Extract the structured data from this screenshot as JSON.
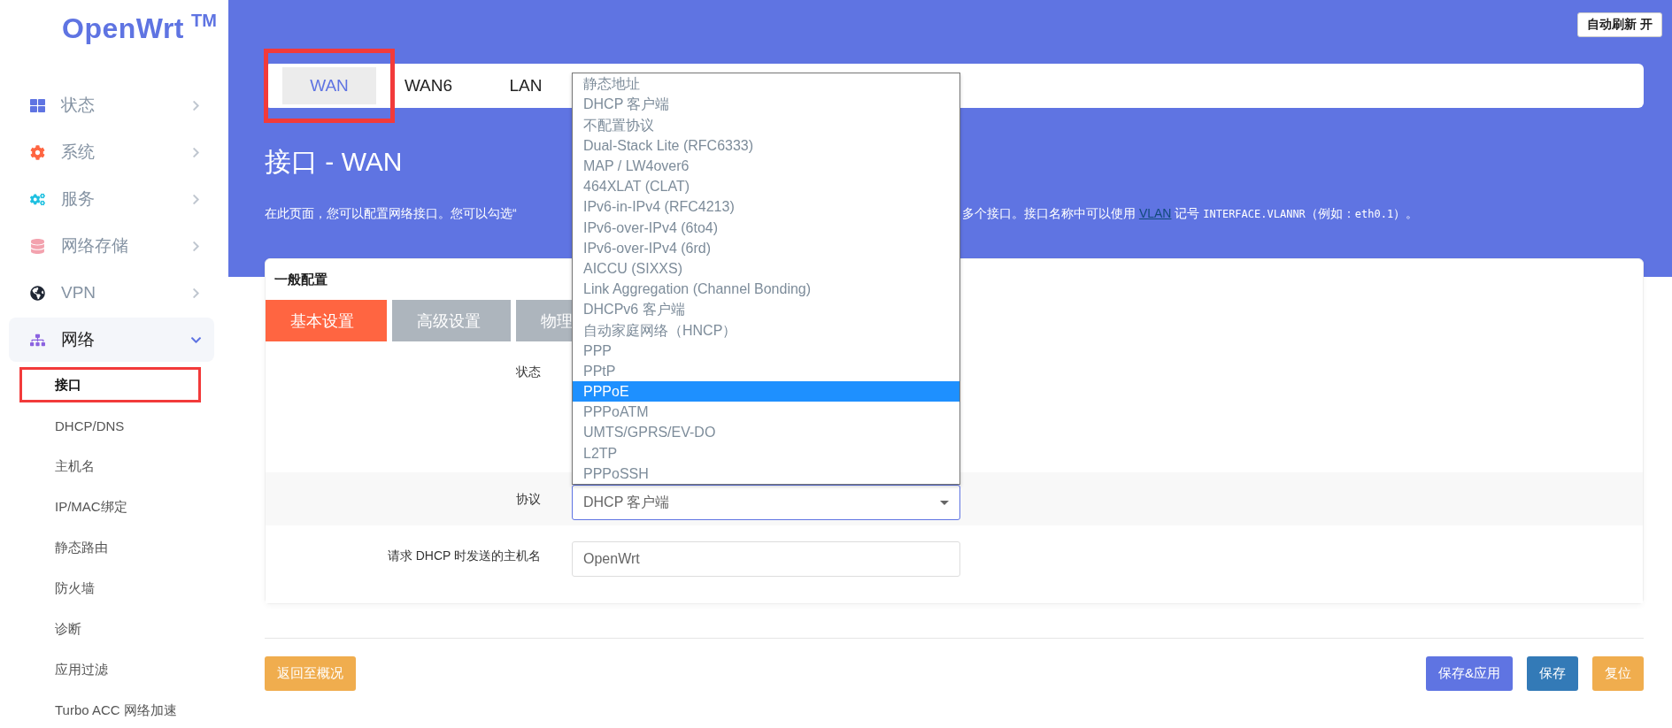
{
  "logo": {
    "name": "OpenWrt",
    "mark": "TM"
  },
  "sidebar": {
    "items": [
      {
        "label": "状态",
        "kind": "status",
        "expanded": false,
        "selected": false
      },
      {
        "label": "系统",
        "kind": "system",
        "expanded": false,
        "selected": false
      },
      {
        "label": "服务",
        "kind": "services",
        "expanded": false,
        "selected": false
      },
      {
        "label": "网络存储",
        "kind": "storage",
        "expanded": false,
        "selected": false
      },
      {
        "label": "VPN",
        "kind": "vpn",
        "expanded": false,
        "selected": false
      },
      {
        "label": "网络",
        "kind": "network",
        "expanded": true,
        "selected": true,
        "children": [
          {
            "label": "接口",
            "selected": true,
            "annotated": true
          },
          {
            "label": "DHCP/DNS",
            "selected": false,
            "annotated": false
          },
          {
            "label": "主机名",
            "selected": false,
            "annotated": false
          },
          {
            "label": "IP/MAC绑定",
            "selected": false,
            "annotated": false
          },
          {
            "label": "静态路由",
            "selected": false,
            "annotated": false
          },
          {
            "label": "防火墙",
            "selected": false,
            "annotated": false
          },
          {
            "label": "诊断",
            "selected": false,
            "annotated": false
          },
          {
            "label": "应用过滤",
            "selected": false,
            "annotated": false
          },
          {
            "label": "Turbo ACC 网络加速",
            "selected": false,
            "annotated": false
          }
        ]
      }
    ]
  },
  "auto_refresh": "自动刷新 开",
  "interface_tabs": [
    {
      "label": "WAN",
      "selected": true,
      "annotated": true
    },
    {
      "label": "WAN6",
      "selected": false,
      "annotated": false
    },
    {
      "label": "LAN",
      "selected": false,
      "annotated": false
    }
  ],
  "page_title": "接口 - WAN",
  "description": {
    "start": "在此页面，您可以配置网络接口。您可以勾选“",
    "end": [
      {
        "kind": "text",
        "text": "多个接口。接口名称中可以使用 "
      },
      {
        "kind": "link",
        "text": "VLAN"
      },
      {
        "kind": "text",
        "text": " 记号 "
      },
      {
        "kind": "code",
        "text": "INTERFACE.VLANNR"
      },
      {
        "kind": "text",
        "text": "（例如："
      },
      {
        "kind": "code",
        "text": "eth0.1"
      },
      {
        "kind": "text",
        "text": "）。"
      }
    ]
  },
  "general": {
    "title": "一般配置",
    "tabs": [
      {
        "label": "基本设置",
        "selected": true
      },
      {
        "label": "高级设置",
        "selected": false
      },
      {
        "label": "物理",
        "selected": false
      }
    ],
    "fields": [
      {
        "kind": "status",
        "label": "状态"
      },
      {
        "kind": "select",
        "label": "协议",
        "value": "DHCP 客户端",
        "expanded": true,
        "options": [
          {
            "label": "静态地址",
            "highlighted": false
          },
          {
            "label": "DHCP 客户端",
            "highlighted": false
          },
          {
            "label": "不配置协议",
            "highlighted": false
          },
          {
            "label": "Dual-Stack Lite (RFC6333)",
            "highlighted": false
          },
          {
            "label": "MAP / LW4over6",
            "highlighted": false
          },
          {
            "label": "464XLAT (CLAT)",
            "highlighted": false
          },
          {
            "label": "IPv6-in-IPv4 (RFC4213)",
            "highlighted": false
          },
          {
            "label": "IPv6-over-IPv4 (6to4)",
            "highlighted": false
          },
          {
            "label": "IPv6-over-IPv4 (6rd)",
            "highlighted": false
          },
          {
            "label": "AICCU (SIXXS)",
            "highlighted": false
          },
          {
            "label": "Link Aggregation (Channel Bonding)",
            "highlighted": false
          },
          {
            "label": "DHCPv6 客户端",
            "highlighted": false
          },
          {
            "label": "自动家庭网络（HNCP）",
            "highlighted": false
          },
          {
            "label": "PPP",
            "highlighted": false
          },
          {
            "label": "PPtP",
            "highlighted": false
          },
          {
            "label": "PPPoE",
            "highlighted": true
          },
          {
            "label": "PPPoATM",
            "highlighted": false
          },
          {
            "label": "UMTS/GPRS/EV-DO",
            "highlighted": false
          },
          {
            "label": "L2TP",
            "highlighted": false
          },
          {
            "label": "PPPoSSH",
            "highlighted": false
          }
        ]
      },
      {
        "kind": "text",
        "label": "请求 DHCP 时发送的主机名",
        "placeholder": "OpenWrt"
      }
    ]
  },
  "footer_buttons": [
    {
      "label": "返回至概况",
      "kind": "back"
    },
    {
      "label": "保存&应用",
      "kind": "apply"
    },
    {
      "label": "保存",
      "kind": "save"
    },
    {
      "label": "复位",
      "kind": "reset"
    }
  ]
}
